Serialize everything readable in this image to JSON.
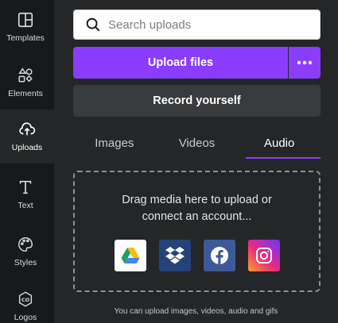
{
  "sidebar": {
    "items": [
      {
        "label": "Templates",
        "icon": "templates-icon",
        "active": false
      },
      {
        "label": "Elements",
        "icon": "elements-icon",
        "active": false
      },
      {
        "label": "Uploads",
        "icon": "upload-cloud-icon",
        "active": true
      },
      {
        "label": "Text",
        "icon": "text-icon",
        "active": false
      },
      {
        "label": "Styles",
        "icon": "palette-icon",
        "active": false
      },
      {
        "label": "Logos",
        "icon": "logo-icon",
        "active": false
      }
    ]
  },
  "search": {
    "placeholder": "Search uploads",
    "value": ""
  },
  "upload": {
    "label": "Upload files",
    "more_icon": "more-horizontal-icon"
  },
  "record": {
    "label": "Record yourself"
  },
  "tabs": [
    {
      "label": "Images",
      "active": false
    },
    {
      "label": "Videos",
      "active": false
    },
    {
      "label": "Audio",
      "active": true
    }
  ],
  "dropzone": {
    "line1": "Drag media here to upload or",
    "line2": "connect an account...",
    "connectors": [
      "google-drive-icon",
      "dropbox-icon",
      "facebook-icon",
      "instagram-icon"
    ]
  },
  "footer": {
    "note": "You can upload images, videos, audio and gifs"
  },
  "colors": {
    "accent": "#8b3dff",
    "sidebar_bg": "#18191b",
    "panel_bg": "#252627"
  }
}
